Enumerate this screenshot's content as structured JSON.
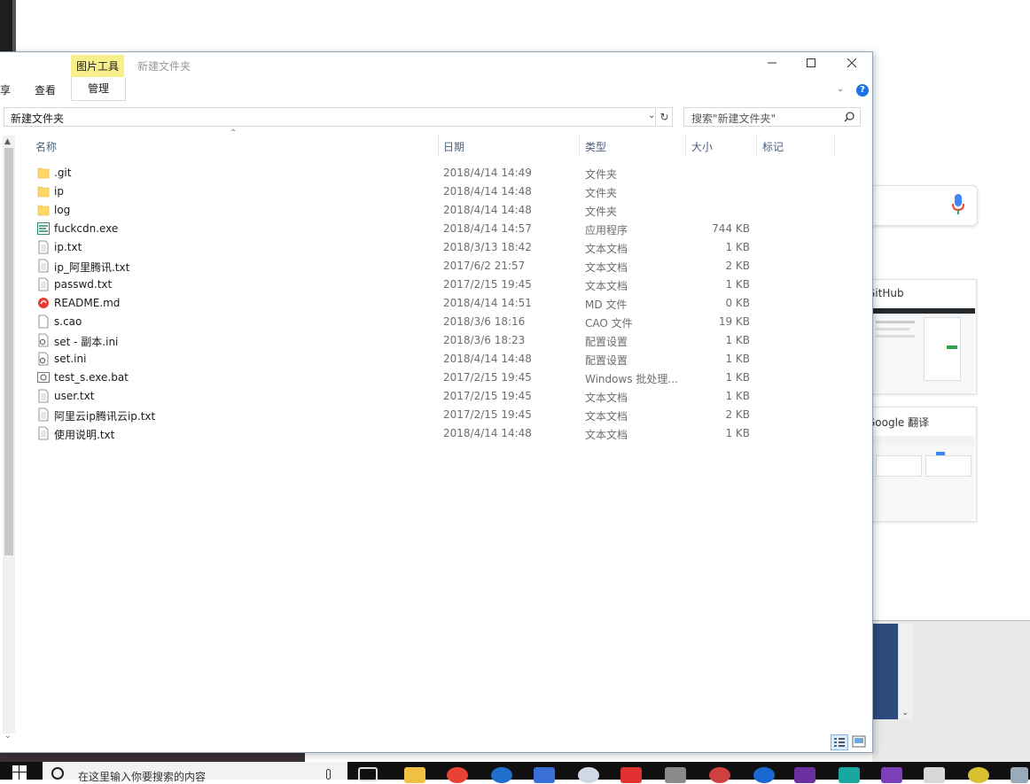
{
  "explorer": {
    "title": "新建文件夹",
    "picture_tools_tab": "图片工具",
    "ribbon_tabs": {
      "share": "享",
      "view": "查看",
      "manage": "管理"
    },
    "help": "?",
    "address": "新建文件夹",
    "search_placeholder": "搜索\"新建文件夹\"",
    "columns": {
      "name": "名称",
      "date": "日期",
      "type": "类型",
      "size": "大小",
      "tags": "标记"
    },
    "files": [
      {
        "name": ".git",
        "date": "2018/4/14 14:49",
        "type": "文件夹",
        "size": "",
        "icon": "folder-icon"
      },
      {
        "name": "ip",
        "date": "2018/4/14 14:48",
        "type": "文件夹",
        "size": "",
        "icon": "folder-icon"
      },
      {
        "name": "log",
        "date": "2018/4/14 14:48",
        "type": "文件夹",
        "size": "",
        "icon": "folder-icon"
      },
      {
        "name": "fuckcdn.exe",
        "date": "2018/4/14 14:57",
        "type": "应用程序",
        "size": "744 KB",
        "icon": "exe-icon"
      },
      {
        "name": "ip.txt",
        "date": "2018/3/13 18:42",
        "type": "文本文档",
        "size": "1 KB",
        "icon": "text-file-icon"
      },
      {
        "name": "ip_阿里腾讯.txt",
        "date": "2017/6/2 21:57",
        "type": "文本文档",
        "size": "2 KB",
        "icon": "text-file-icon"
      },
      {
        "name": "passwd.txt",
        "date": "2017/2/15 19:45",
        "type": "文本文档",
        "size": "1 KB",
        "icon": "text-file-icon"
      },
      {
        "name": "README.md",
        "date": "2018/4/14 14:51",
        "type": "MD 文件",
        "size": "0 KB",
        "icon": "markdown-icon"
      },
      {
        "name": "s.cao",
        "date": "2018/3/6 18:16",
        "type": "CAO 文件",
        "size": "19 KB",
        "icon": "blank-file-icon"
      },
      {
        "name": "set - 副本.ini",
        "date": "2018/3/6 18:23",
        "type": "配置设置",
        "size": "1 KB",
        "icon": "ini-file-icon"
      },
      {
        "name": "set.ini",
        "date": "2018/4/14 14:48",
        "type": "配置设置",
        "size": "1 KB",
        "icon": "ini-file-icon"
      },
      {
        "name": "test_s.exe.bat",
        "date": "2017/2/15 19:45",
        "type": "Windows 批处理...",
        "size": "1 KB",
        "icon": "bat-file-icon"
      },
      {
        "name": "user.txt",
        "date": "2017/2/15 19:45",
        "type": "文本文档",
        "size": "1 KB",
        "icon": "text-file-icon"
      },
      {
        "name": "阿里云ip腾讯云ip.txt",
        "date": "2017/2/15 19:45",
        "type": "文本文档",
        "size": "2 KB",
        "icon": "text-file-icon"
      },
      {
        "name": "使用说明.txt",
        "date": "2018/4/14 14:48",
        "type": "文本文档",
        "size": "1 KB",
        "icon": "text-file-icon"
      }
    ]
  },
  "background": {
    "tile_github": "GitHub",
    "tile_translate": "Google 翻译"
  },
  "taskbar": {
    "search_placeholder": "在这里输入你要搜索的内容"
  },
  "colors": {
    "accent": "#1a73e8",
    "picture_tools": "#f7ef8a",
    "folder": "#ffd766"
  }
}
